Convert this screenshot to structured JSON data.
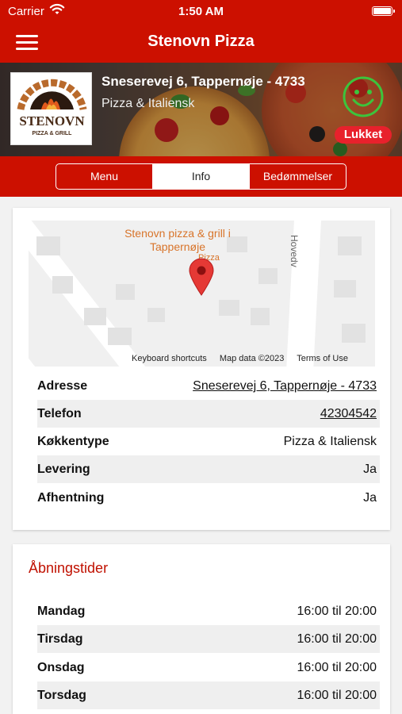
{
  "status_bar": {
    "carrier": "Carrier",
    "time": "1:50 AM"
  },
  "nav": {
    "title": "Stenovn Pizza"
  },
  "restaurant": {
    "address": "Sneserevej 6, Tappernøje - 4733",
    "cuisine": "Pizza & Italiensk",
    "status": "Lukket",
    "logo_name": "STENOVN",
    "logo_sub": "PIZZA & GRILL"
  },
  "tabs": [
    {
      "label": "Menu",
      "active": false
    },
    {
      "label": "Info",
      "active": true
    },
    {
      "label": "Bedømmelser",
      "active": false
    }
  ],
  "map": {
    "place_name": "Stenovn pizza & grill i Tappernøje",
    "place_category": "Pizza",
    "street_label": "Hovedv",
    "footer_links": [
      "Keyboard shortcuts",
      "Map data ©2023",
      "Terms of Use"
    ]
  },
  "info_rows": [
    {
      "label": "Adresse",
      "value": "Sneserevej 6, Tappernøje - 4733",
      "link": true
    },
    {
      "label": "Telefon",
      "value": "42304542",
      "link": true
    },
    {
      "label": "Køkkentype",
      "value": "Pizza & Italiensk",
      "link": false
    },
    {
      "label": "Levering",
      "value": "Ja",
      "link": false
    },
    {
      "label": "Afhentning",
      "value": "Ja",
      "link": false
    }
  ],
  "hours": {
    "title": "Åbningstider",
    "days": [
      {
        "day": "Mandag",
        "time": "16:00 til 20:00"
      },
      {
        "day": "Tirsdag",
        "time": "16:00 til 20:00"
      },
      {
        "day": "Onsdag",
        "time": "16:00 til 20:00"
      },
      {
        "day": "Torsdag",
        "time": "16:00 til 20:00"
      }
    ]
  },
  "colors": {
    "brand": "#cc1000",
    "closed_badge": "#e8212c",
    "smiley": "#3cc43c",
    "accent_text": "#c01000"
  }
}
